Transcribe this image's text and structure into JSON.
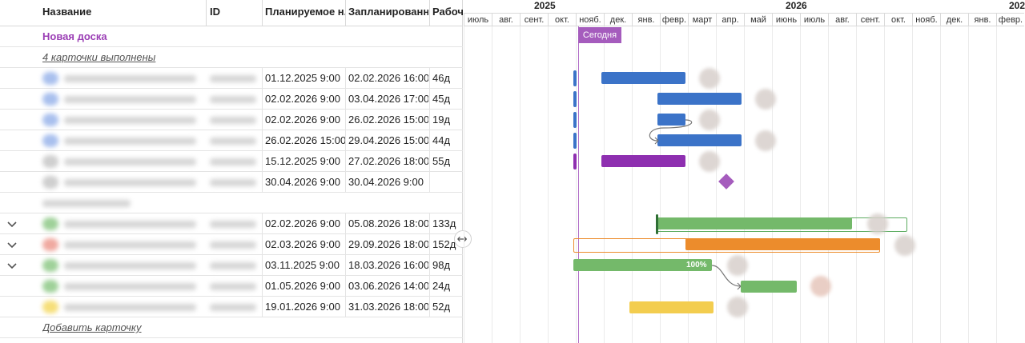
{
  "columns": {
    "name": "Название",
    "id": "ID",
    "planned_start": "Планируемое н...",
    "planned_end": "Запланированн...",
    "work": "Рабоч"
  },
  "board": {
    "title": "Новая доска"
  },
  "groups": {
    "done_link": "4 карточки выполнены"
  },
  "rows": [
    {
      "start": "01.12.2025 9:00",
      "end": "02.02.2026 16:00",
      "work": "46д"
    },
    {
      "start": "02.02.2026 9:00",
      "end": "03.04.2026 17:00",
      "work": "45д"
    },
    {
      "start": "02.02.2026 9:00",
      "end": "26.02.2026 15:00",
      "work": "19д"
    },
    {
      "start": "26.02.2026 15:00",
      "end": "29.04.2026 15:00",
      "work": "44д"
    },
    {
      "start": "15.12.2025 9:00",
      "end": "27.02.2026 18:00",
      "work": "55д"
    },
    {
      "start": "30.04.2026 9:00",
      "end": "30.04.2026 9:00",
      "work": ""
    },
    {
      "start": "02.02.2026 9:00",
      "end": "05.08.2026 18:00",
      "work": "133д"
    },
    {
      "start": "02.03.2026 9:00",
      "end": "29.09.2026 18:00",
      "work": "152д"
    },
    {
      "start": "03.11.2025 9:00",
      "end": "18.03.2026 16:00",
      "work": "98д"
    },
    {
      "start": "01.05.2026 9:00",
      "end": "03.06.2026 14:00",
      "work": "24д"
    },
    {
      "start": "19.01.2026 9:00",
      "end": "31.03.2026 18:00",
      "work": "52д"
    }
  ],
  "footer": {
    "add_card": "Добавить карточку"
  },
  "gantt": {
    "years": {
      "y2025": "2025",
      "y2026": "2026",
      "y2027_partial": "202"
    },
    "months": [
      "июль",
      "авг.",
      "сент.",
      "окт.",
      "нояб.",
      "дек.",
      "янв.",
      "февр.",
      "март",
      "апр.",
      "май",
      "июнь",
      "июль",
      "авг.",
      "сент.",
      "окт.",
      "нояб.",
      "дек.",
      "янв.",
      "февр."
    ],
    "today_label": "Сегодня",
    "progress_label": "100%"
  },
  "colors": {
    "blue": "#3b73c8",
    "purple": "#8e2fb0",
    "green": "#74b96a",
    "orange": "#ec8c2c",
    "yellow": "#f3cd4f",
    "milestone": "#a55cbd",
    "today": "#a55cbd"
  }
}
